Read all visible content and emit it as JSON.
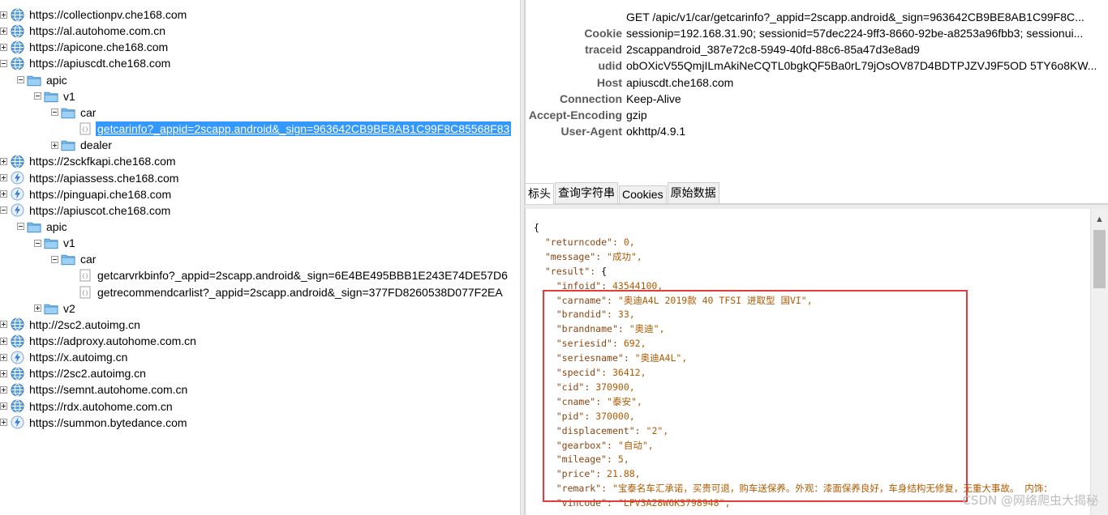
{
  "tree": [
    {
      "depth": 0,
      "exp": "plus",
      "icon": "globe",
      "label": "https://collectionpv.che168.com"
    },
    {
      "depth": 0,
      "exp": "plus",
      "icon": "globe",
      "label": "https://al.autohome.com.cn"
    },
    {
      "depth": 0,
      "exp": "plus",
      "icon": "globe",
      "label": "https://apicone.che168.com"
    },
    {
      "depth": 0,
      "exp": "minus",
      "icon": "globe",
      "label": "https://apiuscdt.che168.com"
    },
    {
      "depth": 1,
      "exp": "minus",
      "icon": "folder",
      "label": "apic"
    },
    {
      "depth": 2,
      "exp": "minus",
      "icon": "folder",
      "label": "v1"
    },
    {
      "depth": 3,
      "exp": "minus",
      "icon": "folder",
      "label": "car"
    },
    {
      "depth": 4,
      "exp": "none",
      "icon": "json",
      "label": "getcarinfo?_appid=2scapp.android&_sign=963642CB9BE8AB1C99F8C85568F83",
      "selected": true
    },
    {
      "depth": 3,
      "exp": "plus",
      "icon": "folder",
      "label": "dealer"
    },
    {
      "depth": 0,
      "exp": "plus",
      "icon": "globe",
      "label": "https://2sckfkapi.che168.com"
    },
    {
      "depth": 0,
      "exp": "plus",
      "icon": "bolt",
      "label": "https://apiassess.che168.com"
    },
    {
      "depth": 0,
      "exp": "plus",
      "icon": "bolt",
      "label": "https://pinguapi.che168.com"
    },
    {
      "depth": 0,
      "exp": "minus",
      "icon": "bolt",
      "label": "https://apiuscot.che168.com"
    },
    {
      "depth": 1,
      "exp": "minus",
      "icon": "folder",
      "label": "apic"
    },
    {
      "depth": 2,
      "exp": "minus",
      "icon": "folder",
      "label": "v1"
    },
    {
      "depth": 3,
      "exp": "minus",
      "icon": "folder",
      "label": "car"
    },
    {
      "depth": 4,
      "exp": "none",
      "icon": "json",
      "label": "getcarvrkbinfo?_appid=2scapp.android&_sign=6E4BE495BBB1E243E74DE57D6"
    },
    {
      "depth": 4,
      "exp": "none",
      "icon": "json",
      "label": "getrecommendcarlist?_appid=2scapp.android&_sign=377FD8260538D077F2EA"
    },
    {
      "depth": 2,
      "exp": "plus",
      "icon": "folder",
      "label": "v2"
    },
    {
      "depth": 0,
      "exp": "plus",
      "icon": "globe",
      "label": "http://2sc2.autoimg.cn"
    },
    {
      "depth": 0,
      "exp": "plus",
      "icon": "globe",
      "label": "https://adproxy.autohome.com.cn"
    },
    {
      "depth": 0,
      "exp": "plus",
      "icon": "bolt",
      "label": "https://x.autoimg.cn"
    },
    {
      "depth": 0,
      "exp": "plus",
      "icon": "globe",
      "label": "https://2sc2.autoimg.cn"
    },
    {
      "depth": 0,
      "exp": "plus",
      "icon": "globe",
      "label": "https://semnt.autohome.com.cn"
    },
    {
      "depth": 0,
      "exp": "plus",
      "icon": "globe",
      "label": "https://rdx.autohome.com.cn"
    },
    {
      "depth": 0,
      "exp": "plus",
      "icon": "bolt",
      "label": "https://summon.bytedance.com"
    }
  ],
  "request": {
    "request_line": "GET /apic/v1/car/getcarinfo?_appid=2scapp.android&_sign=963642CB9BE8AB1C99F8C...",
    "headers": [
      {
        "key": "Cookie",
        "value": "sessionip=192.168.31.90; sessionid=57dec224-9ff3-8660-92be-a8253a96fbb3; sessionui..."
      },
      {
        "key": "traceid",
        "value": "2scappandroid_387e72c8-5949-40fd-88c6-85a47d3e8ad9"
      },
      {
        "key": "udid",
        "value": "obOXicV55QmjILmAkiNeCQTL0bgkQF5Ba0rL79jOsOV87D4BDTPJZVJ9F5OD 5TY6o8KW..."
      },
      {
        "key": "Host",
        "value": "apiuscdt.che168.com"
      },
      {
        "key": "Connection",
        "value": "Keep-Alive"
      },
      {
        "key": "Accept-Encoding",
        "value": "gzip"
      },
      {
        "key": "User-Agent",
        "value": "okhttp/4.9.1"
      }
    ]
  },
  "tabs": [
    {
      "label": "标头",
      "active": true
    },
    {
      "label": "查询字符串",
      "active": false
    },
    {
      "label": "Cookies",
      "active": false
    },
    {
      "label": "原始数据",
      "active": false
    }
  ],
  "response_lines": [
    {
      "indent": 0,
      "key": null,
      "val": "{",
      "vtype": "p"
    },
    {
      "indent": 1,
      "key": "returncode",
      "val": "0,",
      "vtype": "n"
    },
    {
      "indent": 1,
      "key": "message",
      "val": "\"成功\",",
      "vtype": "s"
    },
    {
      "indent": 1,
      "key": "result",
      "val": "{",
      "vtype": "p"
    },
    {
      "indent": 2,
      "key": "infoid",
      "val": "43544100,",
      "vtype": "n"
    },
    {
      "indent": 2,
      "key": "carname",
      "val": "\"奥迪A4L 2019款 40 TFSI 进取型 国VI\",",
      "vtype": "s"
    },
    {
      "indent": 2,
      "key": "brandid",
      "val": "33,",
      "vtype": "n"
    },
    {
      "indent": 2,
      "key": "brandname",
      "val": "\"奥迪\",",
      "vtype": "s"
    },
    {
      "indent": 2,
      "key": "seriesid",
      "val": "692,",
      "vtype": "n"
    },
    {
      "indent": 2,
      "key": "seriesname",
      "val": "\"奥迪A4L\",",
      "vtype": "s"
    },
    {
      "indent": 2,
      "key": "specid",
      "val": "36412,",
      "vtype": "n"
    },
    {
      "indent": 2,
      "key": "cid",
      "val": "370900,",
      "vtype": "n"
    },
    {
      "indent": 2,
      "key": "cname",
      "val": "\"泰安\",",
      "vtype": "s"
    },
    {
      "indent": 2,
      "key": "pid",
      "val": "370000,",
      "vtype": "n"
    },
    {
      "indent": 2,
      "key": "displacement",
      "val": "\"2\",",
      "vtype": "s"
    },
    {
      "indent": 2,
      "key": "gearbox",
      "val": "\"自动\",",
      "vtype": "s"
    },
    {
      "indent": 2,
      "key": "mileage",
      "val": "5,",
      "vtype": "n"
    },
    {
      "indent": 2,
      "key": "price",
      "val": "21.88,",
      "vtype": "n"
    },
    {
      "indent": 2,
      "key": "remark",
      "val": "\"宝泰名车汇承诺，买贵可退，购车送保养。外观：漆面保养良好，车身结构无修复，无重大事故。 内饰：",
      "vtype": "s"
    },
    {
      "indent": 2,
      "key": "vincode",
      "val": "\"LFV3A28W6K3798948\",",
      "vtype": "s"
    }
  ],
  "watermark": "CSDN @网络爬虫大揭秘",
  "colors": {
    "selection": "#3399ff",
    "highlight_box": "#e53b3b",
    "json_key": "#8b4513",
    "json_value": "#b05a00"
  }
}
